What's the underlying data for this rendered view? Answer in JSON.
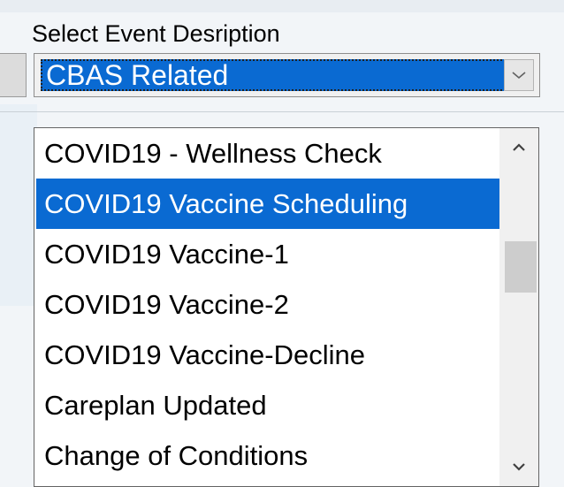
{
  "form": {
    "field_label": "Select Event Desription",
    "selected_value": "CBAS Related"
  },
  "dropdown": {
    "items": [
      "COVID19 - Wellness Check",
      "COVID19 Vaccine Scheduling",
      "COVID19 Vaccine-1",
      "COVID19 Vaccine-2",
      "COVID19 Vaccine-Decline",
      "Careplan Updated",
      "Change of Conditions"
    ],
    "highlighted_index": 1
  },
  "icons": {
    "combo_arrow": "chevron-down-icon",
    "scroll_up": "chevron-up-icon",
    "scroll_down": "chevron-down-icon"
  },
  "colors": {
    "selection": "#0a6ad2",
    "selection_text": "#ffffff"
  }
}
